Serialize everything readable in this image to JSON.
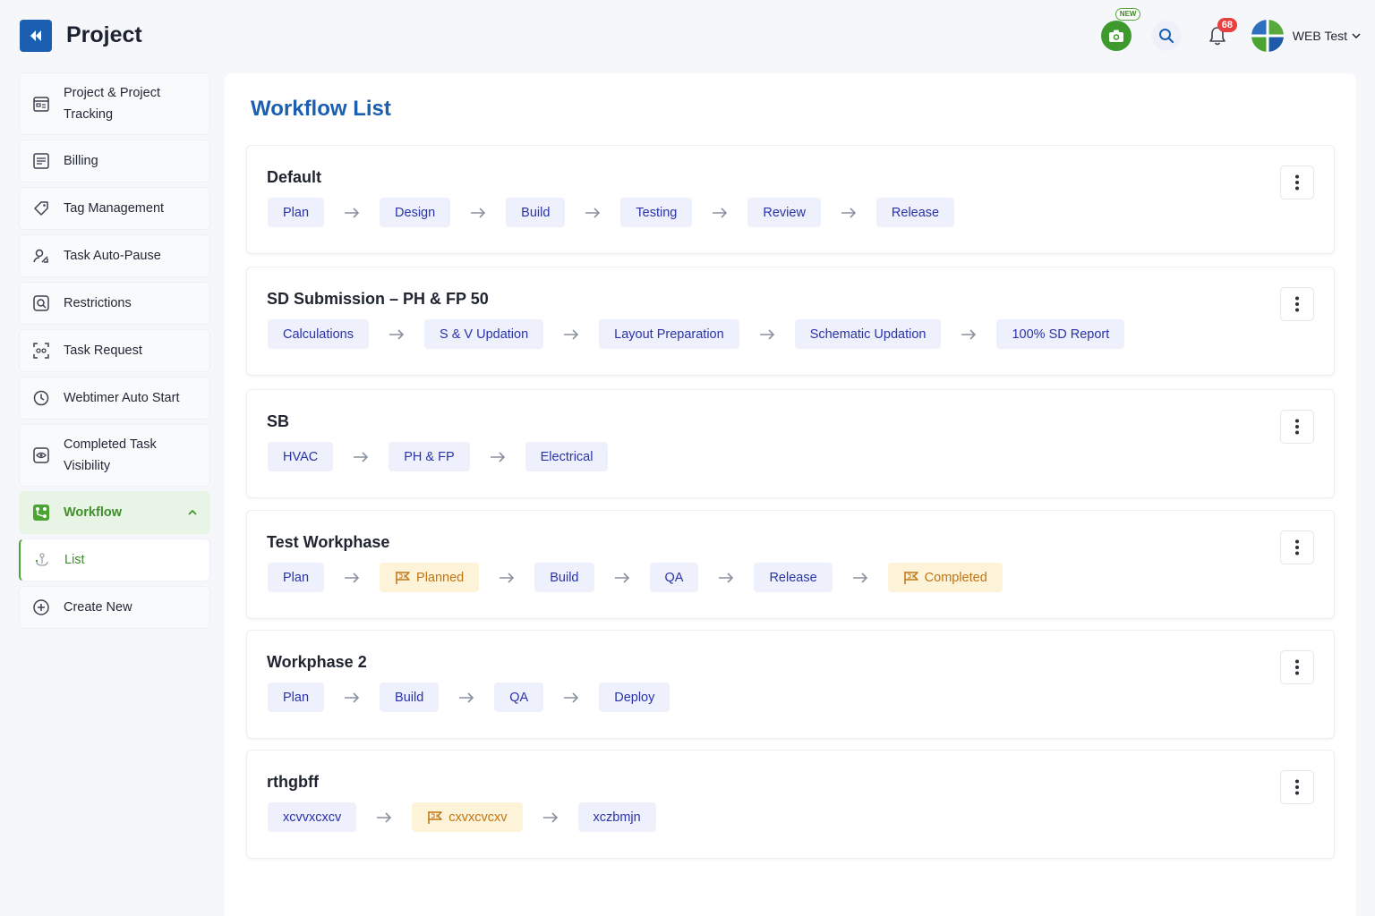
{
  "app": {
    "title": "Project"
  },
  "header": {
    "new_badge": "NEW",
    "notification_count": "68",
    "user_name": "WEB Test"
  },
  "sidebar": {
    "items": [
      {
        "label_line1": "Project & Project",
        "label_line2": "Tracking",
        "icon": "project-tracking-icon"
      },
      {
        "label": "Billing",
        "icon": "billing-icon"
      },
      {
        "label": "Tag Management",
        "icon": "tag-icon"
      },
      {
        "label": "Task Auto-Pause",
        "icon": "auto-pause-icon"
      },
      {
        "label": "Restrictions",
        "icon": "restriction-icon"
      },
      {
        "label": "Task Request",
        "icon": "task-request-icon"
      },
      {
        "label": "Webtimer Auto Start",
        "icon": "timer-icon"
      },
      {
        "label_line1": "Completed Task",
        "label_line2": "Visibility",
        "icon": "visibility-icon"
      },
      {
        "label": "Workflow",
        "icon": "workflow-icon",
        "active": true
      },
      {
        "label": "List",
        "icon": "list-icon",
        "sub": true
      },
      {
        "label": "Create New",
        "icon": "plus-circle-icon"
      }
    ]
  },
  "main": {
    "title": "Workflow List",
    "workflows": [
      {
        "name": "Default",
        "phases": [
          {
            "label": "Plan"
          },
          {
            "label": "Design"
          },
          {
            "label": "Build"
          },
          {
            "label": "Testing"
          },
          {
            "label": "Review"
          },
          {
            "label": "Release"
          }
        ]
      },
      {
        "name": "SD Submission – PH & FP 50",
        "phases": [
          {
            "label": "Calculations"
          },
          {
            "label": "S & V Updation"
          },
          {
            "label": "Layout Preparation"
          },
          {
            "label": "Schematic Updation"
          },
          {
            "label": "100% SD Report"
          }
        ]
      },
      {
        "name": "SB",
        "phases": [
          {
            "label": "HVAC"
          },
          {
            "label": "PH & FP"
          },
          {
            "label": "Electrical"
          }
        ]
      },
      {
        "name": "Test Workphase",
        "phases": [
          {
            "label": "Plan"
          },
          {
            "label": "Planned",
            "milestone": true
          },
          {
            "label": "Build"
          },
          {
            "label": "QA"
          },
          {
            "label": "Release"
          },
          {
            "label": "Completed",
            "milestone": true
          }
        ]
      },
      {
        "name": "Workphase 2",
        "phases": [
          {
            "label": "Plan"
          },
          {
            "label": "Build"
          },
          {
            "label": "QA"
          },
          {
            "label": "Deploy"
          }
        ]
      },
      {
        "name": "rthgbff",
        "phases": [
          {
            "label": "xcvvxcxcv"
          },
          {
            "label": "cxvxcvcxv",
            "milestone": true
          },
          {
            "label": "xczbmjn"
          }
        ]
      }
    ]
  },
  "colors": {
    "brand_blue": "#1a5fb0",
    "accent_green": "#3f8f2a",
    "chip_bg": "#eef0fc",
    "chip_text": "#2a33a8",
    "milestone_bg": "#fdf3d9",
    "milestone_text": "#c07514"
  }
}
